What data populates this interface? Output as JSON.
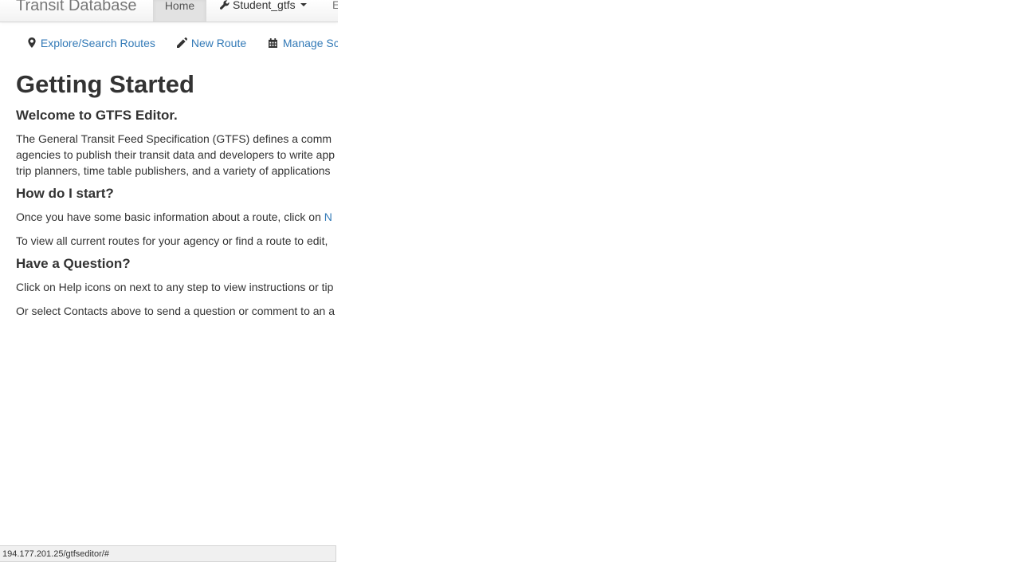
{
  "navbar": {
    "brand": "Transit Database",
    "home": "Home",
    "agency_menu": "Student_gtfs",
    "next_item_partial": "E"
  },
  "subnav": {
    "explore": "Explore/Search Routes",
    "new_route": "New Route",
    "manage": "Manage Sc"
  },
  "content": {
    "title": "Getting Started",
    "welcome_heading": "Welcome to GTFS Editor.",
    "intro_lines": [
      "The General Transit Feed Specification (GTFS) defines a comm",
      "agencies to publish their transit data and developers to write app",
      "trip planners, time table publishers, and a variety of applications"
    ],
    "start_heading": "How do I start?",
    "start_line1_text": "Once you have some basic information about a route, click on ",
    "start_line1_link": "N",
    "start_line2": "To view all current routes for your agency or find a route to edit,",
    "question_heading": "Have a Question?",
    "question_line1": "Click on Help icons on next to any step to view instructions or tip",
    "question_line2": "Or select Contacts above to send a question or comment to an a"
  },
  "statusbar": {
    "url": "194.177.201.25/gtfseditor/#"
  },
  "colors": {
    "link": "#337ab7",
    "text": "#333333",
    "navbar_active": "#e2e2e2"
  },
  "icons": {
    "explore": "map-marker-icon",
    "new_route": "pencil-icon",
    "manage": "calendar-icon",
    "agency_menu": "wrench-icon"
  }
}
